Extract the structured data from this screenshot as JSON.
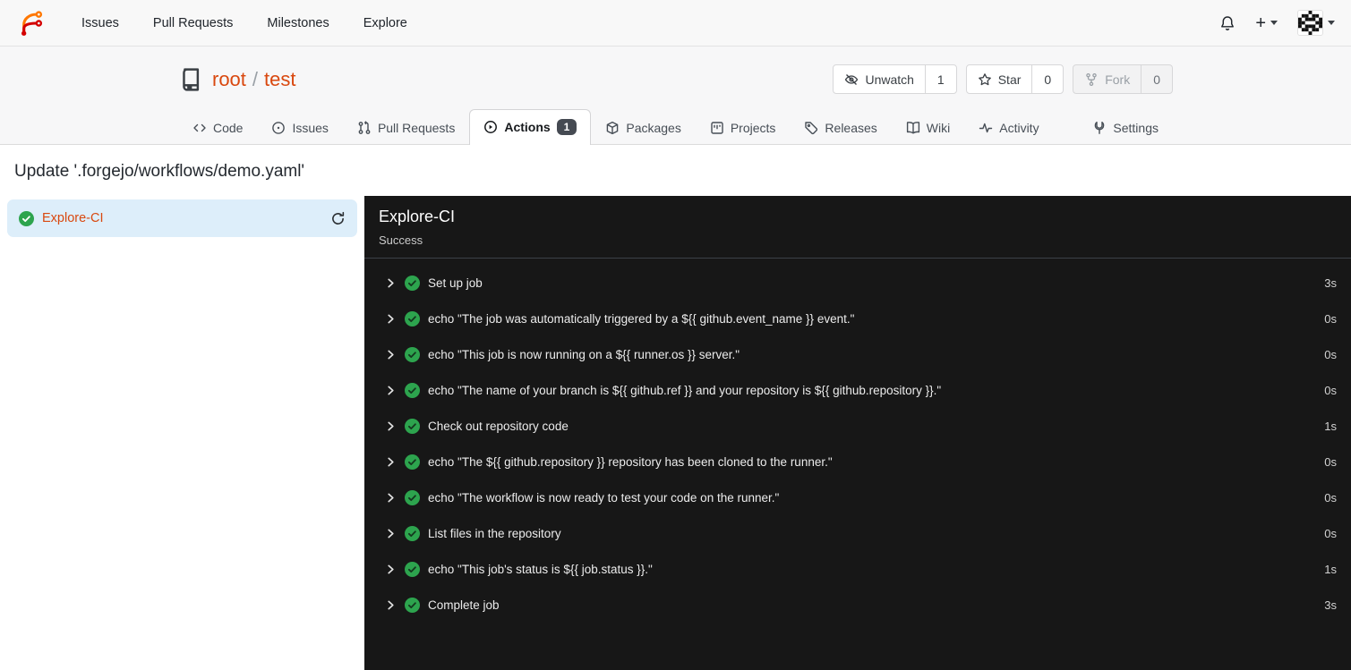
{
  "colors": {
    "accent": "#d9480f",
    "green": "#2da44e",
    "panel-bg": "#171717",
    "sidebar-active": "#ddeefa",
    "badge": "#454a52"
  },
  "navbar": {
    "links": [
      {
        "label": "Issues"
      },
      {
        "label": "Pull Requests"
      },
      {
        "label": "Milestones"
      },
      {
        "label": "Explore"
      }
    ],
    "icons": [
      "forgejo-logo",
      "bell-icon",
      "plus-icon",
      "avatar-identicon"
    ]
  },
  "repo_header": {
    "owner": "root",
    "separator": "/",
    "name": "test",
    "actions": [
      {
        "label": "Unwatch",
        "count": "1",
        "icon": "eye-off-icon",
        "disabled": false
      },
      {
        "label": "Star",
        "count": "0",
        "icon": "star-icon",
        "disabled": false
      },
      {
        "label": "Fork",
        "count": "0",
        "icon": "fork-icon",
        "disabled": true
      }
    ]
  },
  "tabs": [
    {
      "label": "Code",
      "icon": "code-icon"
    },
    {
      "label": "Issues",
      "icon": "issue-icon"
    },
    {
      "label": "Pull Requests",
      "icon": "pull-request-icon"
    },
    {
      "label": "Actions",
      "icon": "play-circle-icon",
      "badge": "1",
      "active": true
    },
    {
      "label": "Packages",
      "icon": "package-icon"
    },
    {
      "label": "Projects",
      "icon": "project-icon"
    },
    {
      "label": "Releases",
      "icon": "tag-icon"
    },
    {
      "label": "Wiki",
      "icon": "book-open-icon"
    },
    {
      "label": "Activity",
      "icon": "pulse-icon"
    },
    {
      "label": "Settings",
      "icon": "tools-icon"
    }
  ],
  "run": {
    "title": "Update '.forgejo/workflows/demo.yaml'",
    "job_name": "Explore-CI",
    "status": "Success"
  },
  "steps": [
    {
      "name": "Set up job",
      "duration": "3s"
    },
    {
      "name": "echo \"The job was automatically triggered by a ${{ github.event_name }} event.\"",
      "duration": "0s"
    },
    {
      "name": "echo \"This job is now running on a ${{ runner.os }} server.\"",
      "duration": "0s"
    },
    {
      "name": "echo \"The name of your branch is ${{ github.ref }} and your repository is ${{ github.repository }}.\"",
      "duration": "0s"
    },
    {
      "name": "Check out repository code",
      "duration": "1s"
    },
    {
      "name": "echo \"The ${{ github.repository }} repository has been cloned to the runner.\"",
      "duration": "0s"
    },
    {
      "name": "echo \"The workflow is now ready to test your code on the runner.\"",
      "duration": "0s"
    },
    {
      "name": "List files in the repository",
      "duration": "0s"
    },
    {
      "name": "echo \"This job's status is ${{ job.status }}.\"",
      "duration": "1s"
    },
    {
      "name": "Complete job",
      "duration": "3s"
    }
  ]
}
